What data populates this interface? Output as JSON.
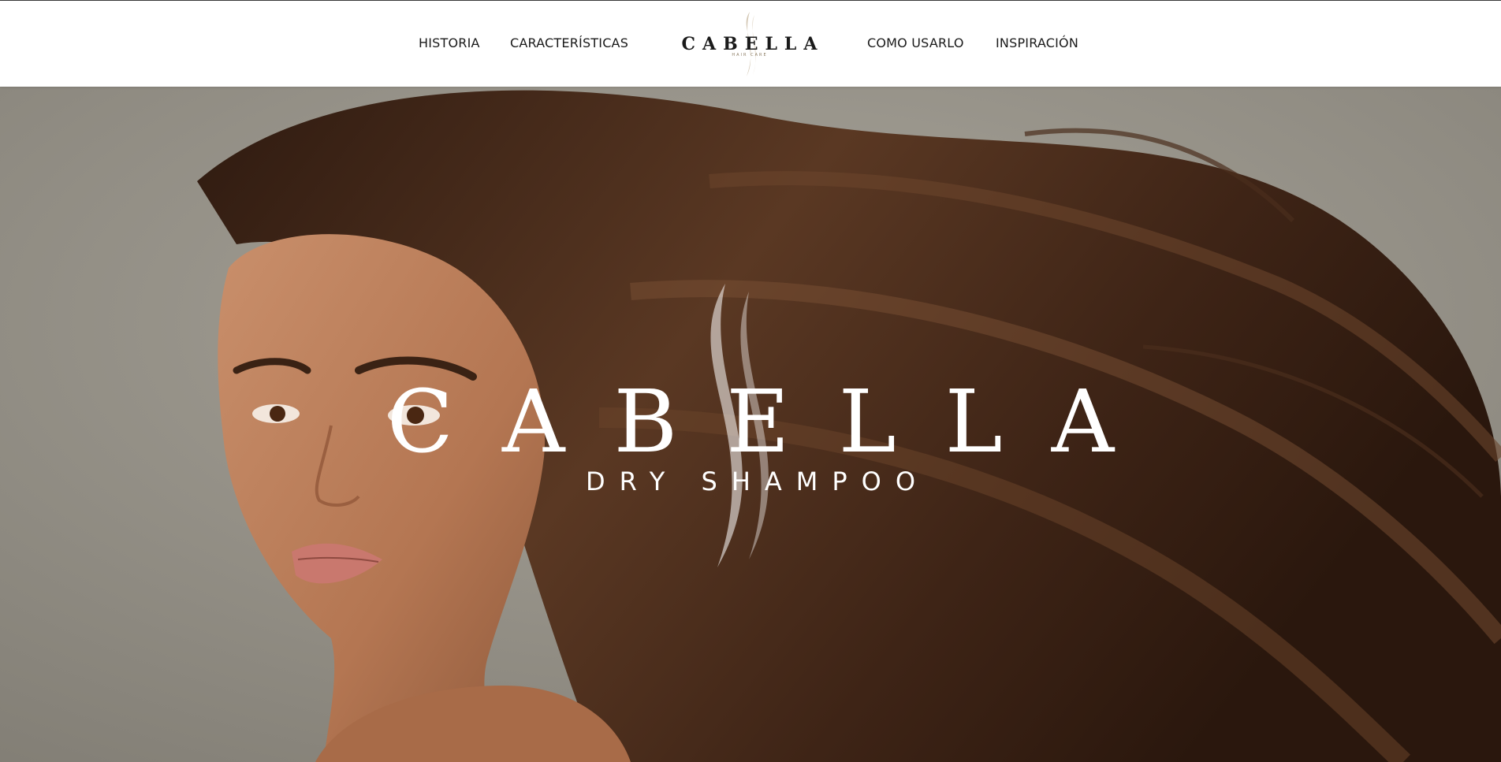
{
  "nav": {
    "items": [
      {
        "label": "HISTORIA"
      },
      {
        "label": "CARACTERÍSTICAS"
      },
      {
        "label": "COMO USARLO"
      },
      {
        "label": "INSPIRACIÓN"
      }
    ]
  },
  "logo": {
    "wordmark": "CABELLA",
    "subtitle": "HAIR CARE"
  },
  "hero": {
    "title": "CABELLA",
    "subtitle": "DRY SHAMPOO"
  },
  "colors": {
    "header_bg": "#ffffff",
    "nav_text": "#1a1a1a",
    "hero_text": "#ffffff",
    "logo_accent": "#b09a78",
    "backdrop": "#8f8b82",
    "hair": "#4a2e1c"
  }
}
